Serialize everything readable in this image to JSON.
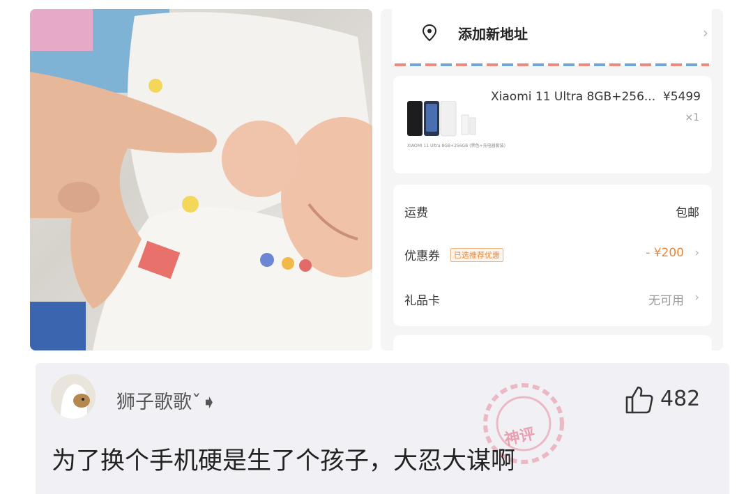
{
  "photo": {
    "alt": "baby holding finger"
  },
  "order": {
    "address": {
      "label": "添加新地址"
    },
    "product": {
      "name": "Xiaomi 11 Ultra 8GB+256...",
      "price": "¥5499",
      "quantity": "×1",
      "thumb_caption": "XIAOMI 11 Ultra 8GB+256GB (黑色+充电器套装)"
    },
    "fees": {
      "shipping_label": "运费",
      "shipping_value": "包邮",
      "coupon_label": "优惠券",
      "coupon_tag": "已选推荐优惠",
      "coupon_value": "- ¥200",
      "giftcard_label": "礼品卡",
      "giftcard_value": "无可用"
    }
  },
  "comment": {
    "username": "狮子歌歌ˇ➧",
    "likes": "482",
    "text": "为了换个手机硬是生了个孩子，大忍大谋啊",
    "watermark": "神评"
  },
  "colors": {
    "accent": "#e8873a",
    "stripe_red": "#f08a80",
    "stripe_blue": "#6fa6dc"
  }
}
